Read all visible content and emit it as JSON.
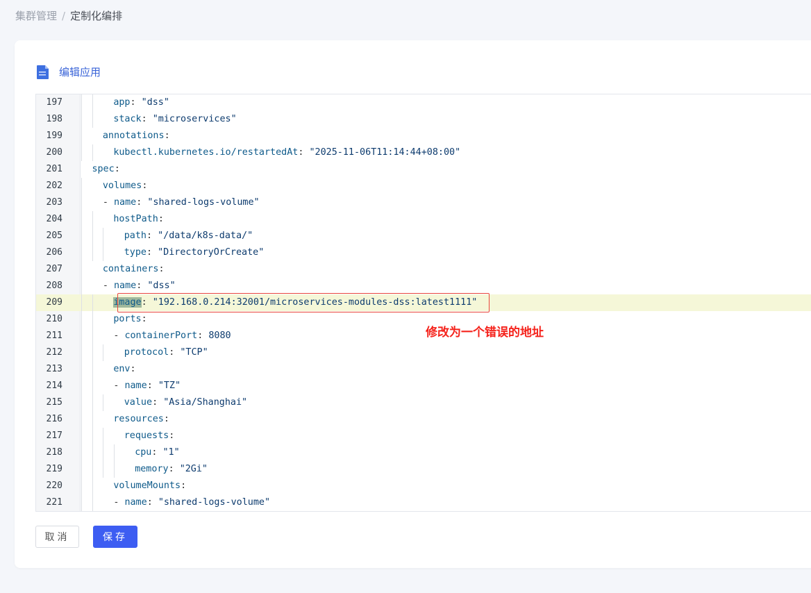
{
  "breadcrumb": {
    "parent": "集群管理",
    "separator": "/",
    "current": "定制化编排"
  },
  "card": {
    "title": "编辑应用",
    "icon": "document-icon"
  },
  "editor": {
    "language": "yaml",
    "highlighted_line": 209,
    "lines": [
      {
        "no": "197",
        "indent": 4,
        "tokens": [
          {
            "t": "k",
            "v": "app"
          },
          {
            "t": "p",
            "v": ": "
          },
          {
            "t": "s",
            "v": "\"dss\""
          }
        ]
      },
      {
        "no": "198",
        "indent": 4,
        "tokens": [
          {
            "t": "k",
            "v": "stack"
          },
          {
            "t": "p",
            "v": ": "
          },
          {
            "t": "s",
            "v": "\"microservices\""
          }
        ]
      },
      {
        "no": "199",
        "indent": 3,
        "tokens": [
          {
            "t": "k",
            "v": "annotations"
          },
          {
            "t": "p",
            "v": ":"
          }
        ]
      },
      {
        "no": "200",
        "indent": 4,
        "tokens": [
          {
            "t": "k",
            "v": "kubectl.kubernetes.io/restartedAt"
          },
          {
            "t": "p",
            "v": ": "
          },
          {
            "t": "s",
            "v": "\"2025-11-06T11:14:44+08:00\""
          }
        ]
      },
      {
        "no": "201",
        "indent": 2,
        "tokens": [
          {
            "t": "k",
            "v": "spec"
          },
          {
            "t": "p",
            "v": ":"
          }
        ]
      },
      {
        "no": "202",
        "indent": 3,
        "tokens": [
          {
            "t": "k",
            "v": "volumes"
          },
          {
            "t": "p",
            "v": ":"
          }
        ]
      },
      {
        "no": "203",
        "indent": 3,
        "tokens": [
          {
            "t": "p",
            "v": "- "
          },
          {
            "t": "k",
            "v": "name"
          },
          {
            "t": "p",
            "v": ": "
          },
          {
            "t": "s",
            "v": "\"shared-logs-volume\""
          }
        ]
      },
      {
        "no": "204",
        "indent": 4,
        "tokens": [
          {
            "t": "k",
            "v": "hostPath"
          },
          {
            "t": "p",
            "v": ":"
          }
        ]
      },
      {
        "no": "205",
        "indent": 5,
        "tokens": [
          {
            "t": "k",
            "v": "path"
          },
          {
            "t": "p",
            "v": ": "
          },
          {
            "t": "s",
            "v": "\"/data/k8s-data/\""
          }
        ]
      },
      {
        "no": "206",
        "indent": 5,
        "tokens": [
          {
            "t": "k",
            "v": "type"
          },
          {
            "t": "p",
            "v": ": "
          },
          {
            "t": "s",
            "v": "\"DirectoryOrCreate\""
          }
        ]
      },
      {
        "no": "207",
        "indent": 3,
        "tokens": [
          {
            "t": "k",
            "v": "containers"
          },
          {
            "t": "p",
            "v": ":"
          }
        ]
      },
      {
        "no": "208",
        "indent": 3,
        "tokens": [
          {
            "t": "p",
            "v": "- "
          },
          {
            "t": "k",
            "v": "name"
          },
          {
            "t": "p",
            "v": ": "
          },
          {
            "t": "s",
            "v": "\"dss\""
          }
        ]
      },
      {
        "no": "209",
        "indent": 4,
        "tokens": [
          {
            "t": "sel",
            "v": "image"
          },
          {
            "t": "p",
            "v": ": "
          },
          {
            "t": "s",
            "v": "\"192.168.0.214:32001/microservices-modules-dss:latest1111\""
          }
        ]
      },
      {
        "no": "210",
        "indent": 4,
        "tokens": [
          {
            "t": "k",
            "v": "ports"
          },
          {
            "t": "p",
            "v": ":"
          }
        ]
      },
      {
        "no": "211",
        "indent": 4,
        "tokens": [
          {
            "t": "p",
            "v": "- "
          },
          {
            "t": "k",
            "v": "containerPort"
          },
          {
            "t": "p",
            "v": ": "
          },
          {
            "t": "n",
            "v": "8080"
          }
        ]
      },
      {
        "no": "212",
        "indent": 5,
        "tokens": [
          {
            "t": "k",
            "v": "protocol"
          },
          {
            "t": "p",
            "v": ": "
          },
          {
            "t": "s",
            "v": "\"TCP\""
          }
        ]
      },
      {
        "no": "213",
        "indent": 4,
        "tokens": [
          {
            "t": "k",
            "v": "env"
          },
          {
            "t": "p",
            "v": ":"
          }
        ]
      },
      {
        "no": "214",
        "indent": 4,
        "tokens": [
          {
            "t": "p",
            "v": "- "
          },
          {
            "t": "k",
            "v": "name"
          },
          {
            "t": "p",
            "v": ": "
          },
          {
            "t": "s",
            "v": "\"TZ\""
          }
        ]
      },
      {
        "no": "215",
        "indent": 5,
        "tokens": [
          {
            "t": "k",
            "v": "value"
          },
          {
            "t": "p",
            "v": ": "
          },
          {
            "t": "s",
            "v": "\"Asia/Shanghai\""
          }
        ]
      },
      {
        "no": "216",
        "indent": 4,
        "tokens": [
          {
            "t": "k",
            "v": "resources"
          },
          {
            "t": "p",
            "v": ":"
          }
        ]
      },
      {
        "no": "217",
        "indent": 5,
        "tokens": [
          {
            "t": "k",
            "v": "requests"
          },
          {
            "t": "p",
            "v": ":"
          }
        ]
      },
      {
        "no": "218",
        "indent": 6,
        "tokens": [
          {
            "t": "k",
            "v": "cpu"
          },
          {
            "t": "p",
            "v": ": "
          },
          {
            "t": "s",
            "v": "\"1\""
          }
        ]
      },
      {
        "no": "219",
        "indent": 6,
        "tokens": [
          {
            "t": "k",
            "v": "memory"
          },
          {
            "t": "p",
            "v": ": "
          },
          {
            "t": "s",
            "v": "\"2Gi\""
          }
        ]
      },
      {
        "no": "220",
        "indent": 4,
        "tokens": [
          {
            "t": "k",
            "v": "volumeMounts"
          },
          {
            "t": "p",
            "v": ":"
          }
        ]
      },
      {
        "no": "221",
        "indent": 4,
        "tokens": [
          {
            "t": "p",
            "v": "- "
          },
          {
            "t": "k",
            "v": "name"
          },
          {
            "t": "p",
            "v": ": "
          },
          {
            "t": "s",
            "v": "\"shared-logs-volume\""
          }
        ]
      }
    ]
  },
  "annotation": {
    "text": "修改为一个错误的地址",
    "color": "#f5221b"
  },
  "actions": {
    "cancel_label": "取消",
    "save_label": "保存"
  },
  "colors": {
    "accent": "#3d5df2",
    "title": "#3a64d8",
    "active_line": "#f5f7d8"
  }
}
